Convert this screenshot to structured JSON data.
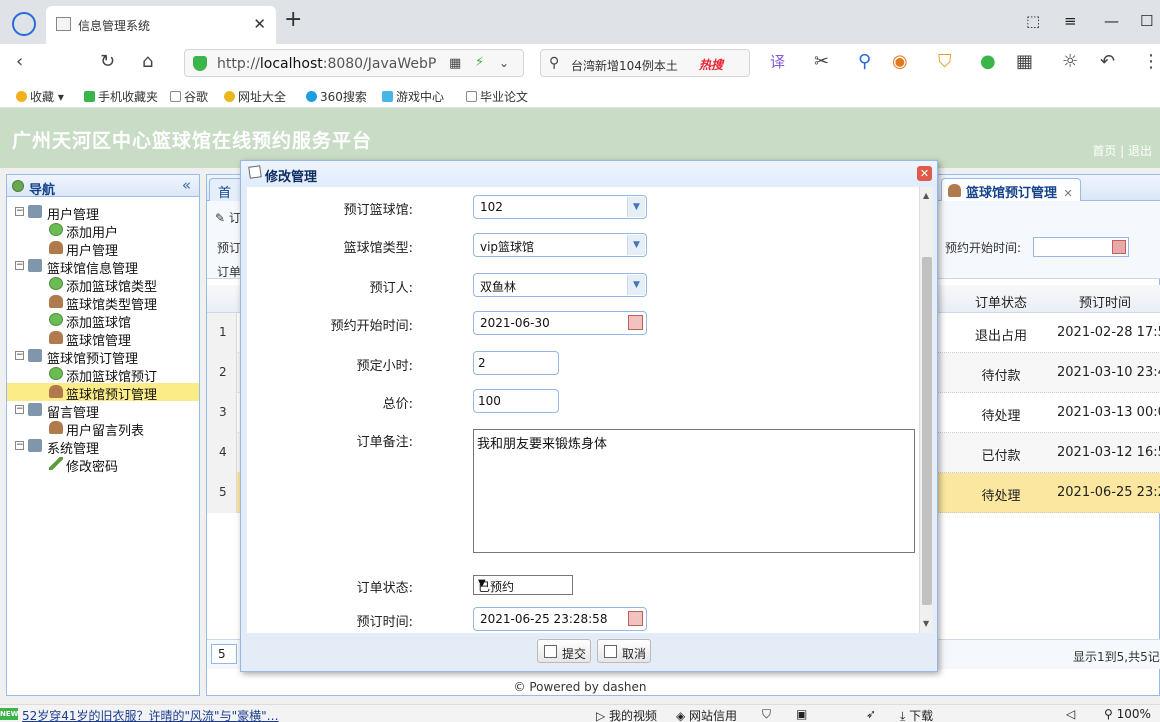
{
  "browser": {
    "tab_title": "信息管理系统",
    "url_prefix": "http://",
    "url_host": "localhost",
    "url_rest": ":8080/JavaWebP",
    "search_text": "台湾新增104例本土",
    "search_hot": "热搜",
    "bookmarks": [
      "收藏",
      "手机收藏夹",
      "谷歌",
      "网址大全",
      "360搜索",
      "游戏中心",
      "毕业论文"
    ]
  },
  "header": {
    "title": "广州天河区中心篮球馆在线预约服务平台",
    "links": "首页 | 退出"
  },
  "nav": {
    "title": "导航",
    "items": [
      {
        "label": "用户管理",
        "level": 0,
        "icon": "folder-icon"
      },
      {
        "label": "添加用户",
        "level": 1,
        "icon": "add-icon"
      },
      {
        "label": "用户管理",
        "level": 1,
        "icon": "user-icon"
      },
      {
        "label": "篮球馆信息管理",
        "level": 0,
        "icon": "folder-icon"
      },
      {
        "label": "添加篮球馆类型",
        "level": 1,
        "icon": "add-icon"
      },
      {
        "label": "篮球馆类型管理",
        "level": 1,
        "icon": "user-icon"
      },
      {
        "label": "添加篮球馆",
        "level": 1,
        "icon": "add-icon"
      },
      {
        "label": "篮球馆管理",
        "level": 1,
        "icon": "user-icon"
      },
      {
        "label": "篮球馆预订管理",
        "level": 0,
        "icon": "folder-icon"
      },
      {
        "label": "添加篮球馆预订",
        "level": 1,
        "icon": "add-icon"
      },
      {
        "label": "篮球馆预订管理",
        "level": 1,
        "icon": "user-icon",
        "selected": true
      },
      {
        "label": "留言管理",
        "level": 0,
        "icon": "folder-icon"
      },
      {
        "label": "用户留言列表",
        "level": 1,
        "icon": "user-icon"
      },
      {
        "label": "系统管理",
        "level": 0,
        "icon": "folder-icon"
      },
      {
        "label": "修改密码",
        "level": 1,
        "icon": "pencil-icon"
      }
    ]
  },
  "center": {
    "first_tab": "首",
    "active_tab": "篮球馆预订管理",
    "search_btn": "订",
    "search_label1": "预订",
    "search_label2": "订单",
    "search_start_label": "预约开始时间:",
    "columns": {
      "status": "订单状态",
      "time": "预订时间"
    },
    "rows": [
      {
        "num": "1",
        "status": "退出占用",
        "time": "2021-02-28 17:5"
      },
      {
        "num": "2",
        "status": "待付款",
        "time": "2021-03-10 23:4"
      },
      {
        "num": "3",
        "status": "待处理",
        "time": "2021-03-13 00:0"
      },
      {
        "num": "4",
        "status": "已付款",
        "time": "2021-03-12 16:5"
      },
      {
        "num": "5",
        "status": "待处理",
        "time": "2021-06-25 23:2"
      }
    ],
    "pager_size": "5",
    "pager_info": "显示1到5,共5记"
  },
  "footer": "© Powered by dashen",
  "dialog": {
    "title": "修改管理",
    "fields": {
      "venue_label": "预订篮球馆:",
      "venue_value": "102",
      "type_label": "篮球馆类型:",
      "type_value": "vip篮球馆",
      "user_label": "预订人:",
      "user_value": "双鱼林",
      "start_label": "预约开始时间:",
      "start_value": "2021-06-30",
      "hours_label": "预定小时:",
      "hours_value": "2",
      "price_label": "总价:",
      "price_value": "100",
      "memo_label": "订单备注:",
      "memo_value": "我和朋友要来锻炼身体",
      "state_label": "订单状态:",
      "state_value": "已预约",
      "time_label": "预订时间:",
      "time_value": "2021-06-25 23:28:58"
    },
    "submit": "提交",
    "cancel": "取消"
  },
  "statusbar": {
    "news": "52岁穿41岁的旧衣服？许晴的\"风流\"与\"豪横\"…",
    "video": "我的视频",
    "credit": "网站信用",
    "download": "下载",
    "zoom": "100%"
  }
}
